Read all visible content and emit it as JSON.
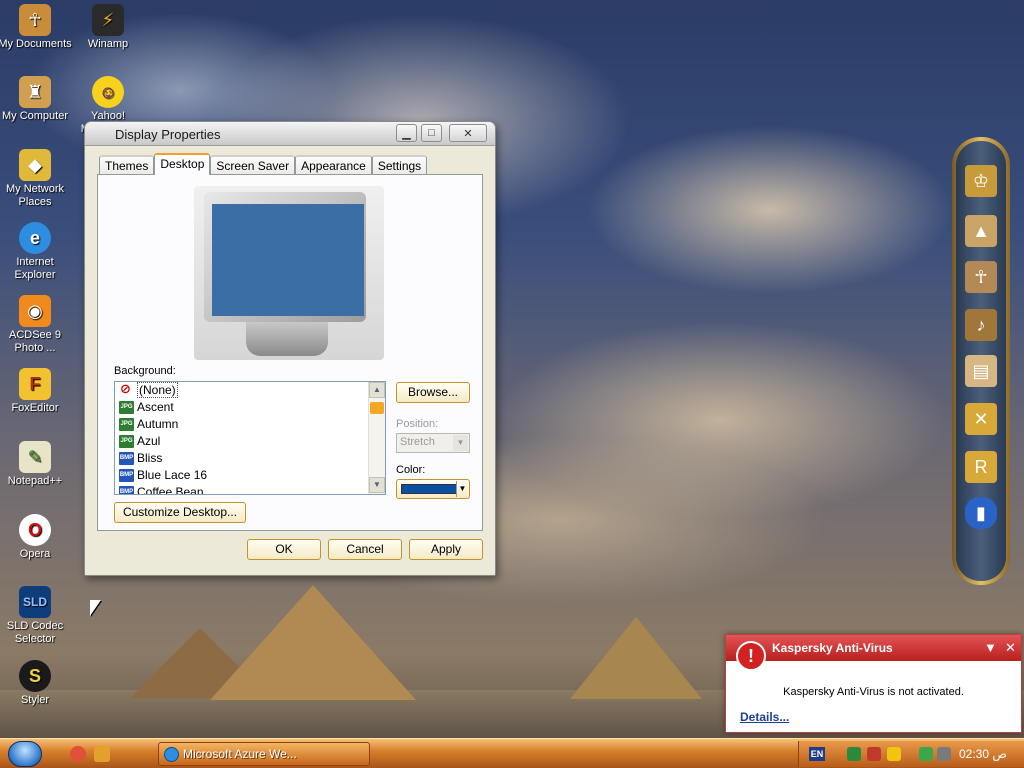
{
  "desktop_icons": [
    {
      "label": "My Documents",
      "icon": "my-documents-icon"
    },
    {
      "label": "Winamp",
      "icon": "winamp-icon"
    },
    {
      "label": "My Computer",
      "icon": "my-computer-icon"
    },
    {
      "label": "Yahoo! Messenger",
      "icon": "yahoo-messenger-icon"
    },
    {
      "label": "My Network Places",
      "icon": "network-places-icon"
    },
    {
      "label": "Internet Explorer",
      "icon": "internet-explorer-icon"
    },
    {
      "label": "ACDSee 9 Photo ...",
      "icon": "acdsee-icon"
    },
    {
      "label": "FoxEditor",
      "icon": "foxeditor-icon"
    },
    {
      "label": "Notepad++",
      "icon": "notepad-plus-icon"
    },
    {
      "label": "Opera",
      "icon": "opera-icon"
    },
    {
      "label": "SLD Codec Selector",
      "icon": "sld-codec-icon"
    },
    {
      "label": "Styler",
      "icon": "styler-icon"
    }
  ],
  "dialog": {
    "title": "Display Properties",
    "tabs": [
      "Themes",
      "Desktop",
      "Screen Saver",
      "Appearance",
      "Settings"
    ],
    "active_tab": "Desktop",
    "background_label": "Background:",
    "background_items": [
      {
        "label": "(None)",
        "type": "none"
      },
      {
        "label": "Ascent",
        "type": "jpg"
      },
      {
        "label": "Autumn",
        "type": "jpg"
      },
      {
        "label": "Azul",
        "type": "jpg"
      },
      {
        "label": "Bliss",
        "type": "bmp"
      },
      {
        "label": "Blue Lace 16",
        "type": "bmp"
      },
      {
        "label": "Coffee Bean",
        "type": "bmp"
      }
    ],
    "file_badges": {
      "jpg": "JPG",
      "bmp": "BMP"
    },
    "browse_button": "Browse...",
    "position_label": "Position:",
    "position_value": "Stretch",
    "color_label": "Color:",
    "color_value": "#0b4fa3",
    "preview_color": "#3a6ea5",
    "customize_button": "Customize Desktop...",
    "ok_button": "OK",
    "cancel_button": "Cancel",
    "apply_button": "Apply"
  },
  "kaspersky": {
    "title": "Kaspersky Anti-Virus",
    "message": "Kaspersky Anti-Virus is not activated.",
    "details_link": "Details..."
  },
  "taskbar": {
    "task_title": "Microsoft Azure We...",
    "language": "EN",
    "clock": "02:30 ص"
  }
}
